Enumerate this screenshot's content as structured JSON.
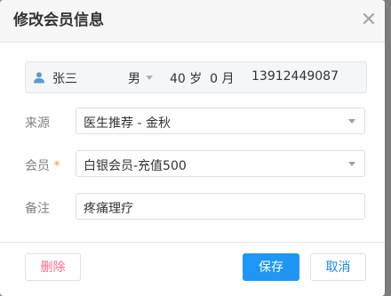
{
  "dialog": {
    "title": "修改会员信息",
    "close_icon": "close-icon"
  },
  "patient": {
    "icon": "user-icon",
    "name": "张三",
    "gender": "男",
    "age_text": "40 岁  0 月",
    "phone": "13912449087"
  },
  "form": {
    "source": {
      "label": "来源",
      "value": "医生推荐 - 金秋"
    },
    "member": {
      "label": "会员",
      "required_mark": "*",
      "value": "白银会员-充值500"
    },
    "remark": {
      "label": "备注",
      "value": "疼痛理疗"
    }
  },
  "footer": {
    "delete_label": "删除",
    "save_label": "保存",
    "cancel_label": "取消"
  },
  "colors": {
    "primary": "#1e96f5",
    "danger": "#f56c8a",
    "required": "#ff9a2e"
  }
}
